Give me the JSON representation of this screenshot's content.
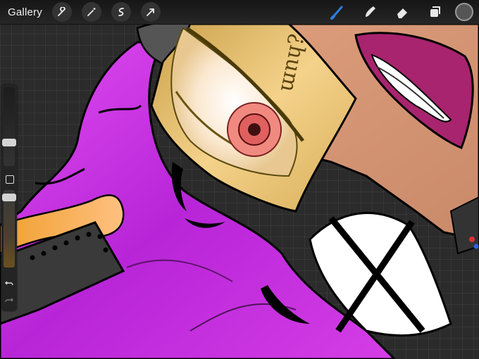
{
  "toolbar": {
    "gallery_label": "Gallery",
    "left_icons": [
      "wrench-icon",
      "magic-wand-icon",
      "selection-icon",
      "transform-arrow-icon"
    ],
    "right_icons": [
      "brush-icon",
      "smudge-icon",
      "eraser-icon",
      "layers-icon"
    ],
    "active_tool": "brush",
    "active_color": "#2f7fe0",
    "current_color": "#555555"
  },
  "sidebar": {
    "brush_size_level": 0.72,
    "brush_opacity_level": 0.05,
    "icons": [
      "modify-square-icon",
      "undo-icon",
      "redo-icon"
    ]
  },
  "artwork": {
    "note_text": "¿hum",
    "colors": {
      "hair": "#c72fe0",
      "skin": "#d99c7a",
      "note": "#e0b756",
      "lips": "#a8246e",
      "glow": "#f5a040"
    }
  }
}
